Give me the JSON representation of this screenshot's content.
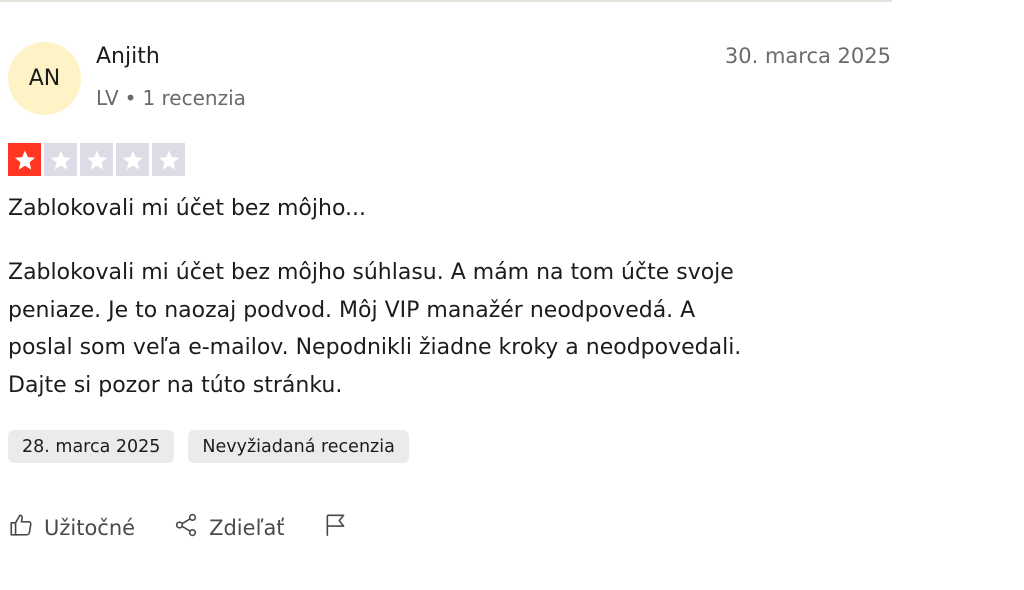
{
  "review": {
    "author": {
      "initials": "AN",
      "name": "Anjith",
      "country": "LV",
      "review_count": "1 recenzia"
    },
    "date": "30. marca 2025",
    "rating": {
      "value": 1,
      "max": 5
    },
    "title": "Zablokovali mi účet bez môjho...",
    "body_lines": [
      "Zablokovali mi účet bez môjho súhlasu. A mám na tom účte svoje",
      "peniaze. Je to naozaj podvod. Môj VIP manažér neodpovedá. A",
      "poslal som veľa e-mailov. Nepodnikli žiadne kroky a neodpovedali.",
      "Dajte si pozor na túto stránku."
    ],
    "experience_date": "28. marca 2025",
    "tag": "Nevyžiadaná recenzia"
  },
  "actions": {
    "useful": "Užitočné",
    "share": "Zdieľať",
    "icons": [
      "thumbs-up-icon",
      "share-icon",
      "flag-icon"
    ]
  },
  "colors": {
    "star_active": "#ff3722",
    "star_inactive": "#dcdce6",
    "avatar_bg": "#fdf3c6",
    "chip_bg": "#ebebeb"
  }
}
